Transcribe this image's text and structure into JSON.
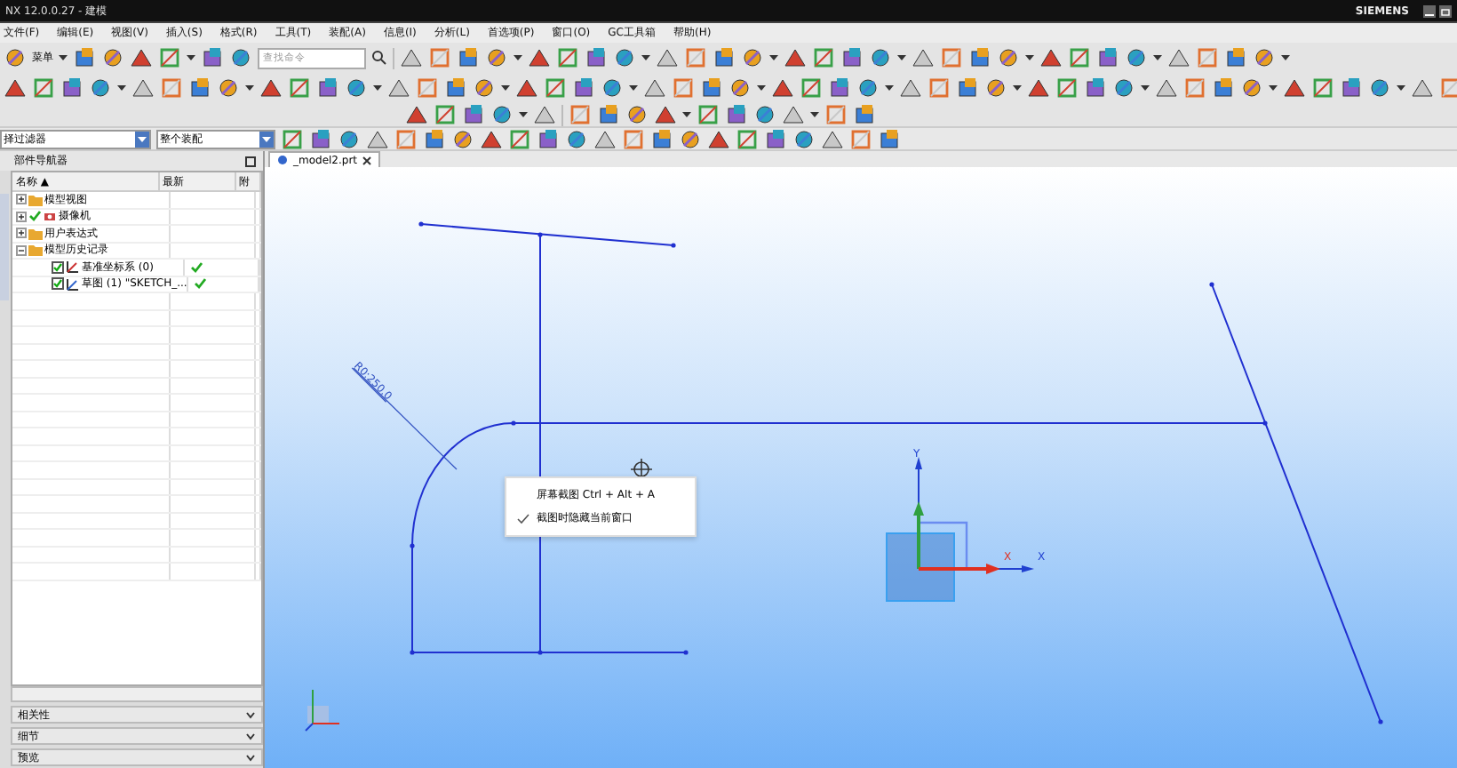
{
  "window": {
    "title": "NX 12.0.0.27 - 建模",
    "brand": "SIEMENS"
  },
  "menu": [
    "文件(F)",
    "编辑(E)",
    "视图(V)",
    "插入(S)",
    "格式(R)",
    "工具(T)",
    "装配(A)",
    "信息(I)",
    "分析(L)",
    "首选项(P)",
    "窗口(O)",
    "GC工具箱",
    "帮助(H)"
  ],
  "toolbar": {
    "menu_button": "菜单",
    "search": {
      "placeholder": "查找命令"
    }
  },
  "selection_bar": {
    "filter": "择过滤器",
    "scope": "整个装配"
  },
  "navigator": {
    "title": "部件导航器",
    "columns": [
      "名称 ▲",
      "最新",
      "附"
    ],
    "tree": [
      {
        "label": "模型视图",
        "expanded": false,
        "checked": false,
        "up_to_date": false
      },
      {
        "label": "摄像机",
        "expanded": false,
        "checked": true,
        "up_to_date": false
      },
      {
        "label": "用户表达式",
        "expanded": false,
        "checked": false,
        "up_to_date": false
      },
      {
        "label": "模型历史记录",
        "expanded": true,
        "checked": false,
        "up_to_date": false,
        "children": [
          {
            "label": "基准坐标系 (0)",
            "checked": true,
            "up_to_date": true
          },
          {
            "label": "草图 (1) \"SKETCH_...",
            "checked": true,
            "up_to_date": true
          }
        ]
      }
    ],
    "panels": [
      "相关性",
      "细节",
      "预览"
    ]
  },
  "document_tab": {
    "label": "_model2.prt"
  },
  "viewport": {
    "dimension": "R0:250.0",
    "csys": {
      "y_label": "Y",
      "x_label": "X",
      "x_label_2": "X"
    }
  },
  "context_menu": [
    {
      "label": "屏幕截图 Ctrl + Alt + A",
      "checked": false
    },
    {
      "label": "截图时隐藏当前窗口",
      "checked": true
    }
  ]
}
